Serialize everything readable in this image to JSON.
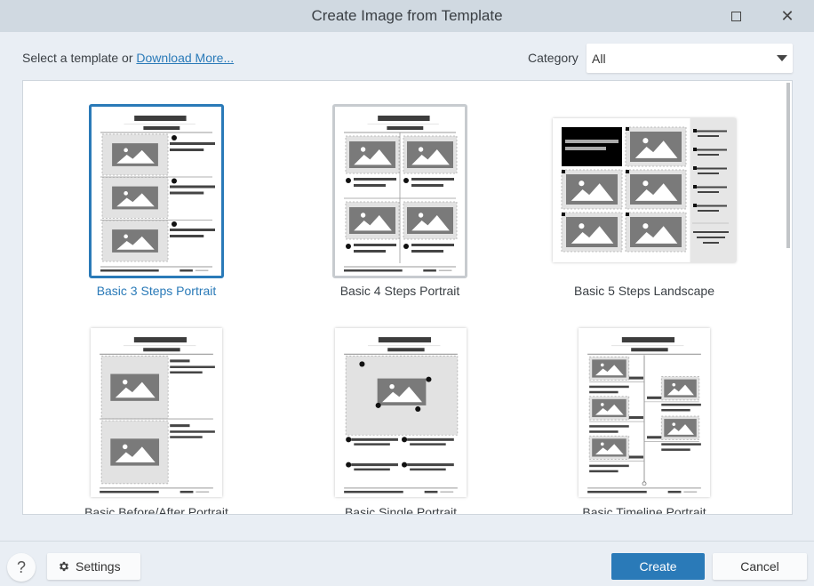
{
  "window": {
    "title": "Create Image from Template",
    "maximize_icon": "maximize-icon",
    "close_icon": "close-icon"
  },
  "header": {
    "prompt_text": "Select a template or ",
    "download_link": "Download More...",
    "category_label": "Category",
    "category_value": "All"
  },
  "templates": [
    {
      "name": "Basic 3 Steps Portrait",
      "selected": true,
      "layout": "steps3"
    },
    {
      "name": "Basic 4 Steps Portrait",
      "selected": false,
      "layout": "steps4"
    },
    {
      "name": "Basic 5 Steps Landscape",
      "selected": false,
      "layout": "steps5"
    },
    {
      "name": "Basic Before/After Portrait",
      "selected": false,
      "layout": "beforeafter"
    },
    {
      "name": "Basic Single Portrait",
      "selected": false,
      "layout": "single"
    },
    {
      "name": "Basic Timeline Portrait",
      "selected": false,
      "layout": "timeline"
    }
  ],
  "footer": {
    "help_label": "?",
    "settings_label": "Settings",
    "create_label": "Create",
    "cancel_label": "Cancel"
  },
  "colors": {
    "accent": "#2a7ab8",
    "titlebar": "#d0d9e1",
    "background": "#e9eef4"
  }
}
